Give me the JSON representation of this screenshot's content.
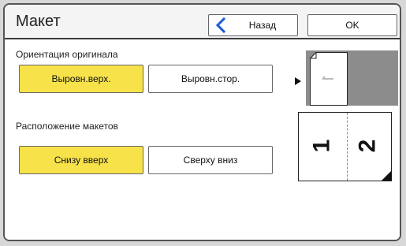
{
  "header": {
    "title": "Макет",
    "back_label": "Назад",
    "ok_label": "OK"
  },
  "orientation": {
    "label": "Ориентация оригинала",
    "options": [
      "Выровн.верх.",
      "Выровн.стор."
    ],
    "selected": "Выровн.верх."
  },
  "layout": {
    "label": "Расположение макетов",
    "options": [
      "Снизу вверх",
      "Сверху вниз"
    ],
    "selected": "Снизу вверх",
    "preview_numbers": [
      "1",
      "2"
    ]
  },
  "colors": {
    "accent": "#f7e24a",
    "preview_bg": "#8c8c8c"
  }
}
